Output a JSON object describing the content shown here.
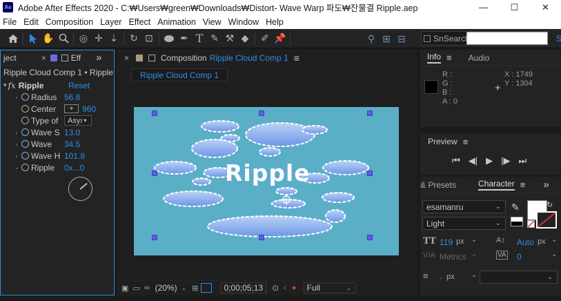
{
  "app": {
    "logo": "Ae",
    "title": "Adobe After Effects 2020 - C:₩Users₩green₩Downloads₩Distort- Wave Warp 파도₩잔물결 Ripple.aep"
  },
  "window_controls": {
    "minimize": "—",
    "maximize": "☐",
    "close": "✕"
  },
  "menu": [
    "File",
    "Edit",
    "Composition",
    "Layer",
    "Effect",
    "Animation",
    "View",
    "Window",
    "Help"
  ],
  "toolbar": {
    "search_help_placeholder": "Search Help",
    "search_help_fragment": "Sn",
    "right_edge_text": "S"
  },
  "effects_panel": {
    "tab_project_fragment": "ject",
    "tab_close": "×",
    "tab_effects_fragment": "Eff",
    "overflow": "»",
    "subtitle": "Ripple Cloud Comp 1 • Ripple",
    "effect_name": "Ripple",
    "reset_label": "Reset",
    "properties": [
      {
        "name": "Radius",
        "value": "56.8"
      },
      {
        "name": "Center",
        "value": "960"
      },
      {
        "name": "Type of",
        "value": "Asyı"
      },
      {
        "name": "Wave S",
        "value": "13.0"
      },
      {
        "name": "Wave",
        "value": "34.5"
      },
      {
        "name": "Wave H",
        "value": "101.8"
      },
      {
        "name": "Ripple",
        "value": "0x...0"
      }
    ]
  },
  "composition_panel": {
    "close": "×",
    "panel_label": "Composition",
    "comp_name": "Ripple Cloud Comp 1",
    "menu_glyph": "≡",
    "tab_label": "Ripple Cloud Comp 1",
    "canvas_text": "Ripple",
    "footer": {
      "zoom": "(20%)",
      "timecode": "0;00;05;13",
      "resolution": "Full"
    }
  },
  "info_panel": {
    "tab_info": "Info",
    "tab_audio": "Audio",
    "menu_glyph": "≡",
    "r_label": "R :",
    "g_label": "G :",
    "b_label": "B :",
    "a_label": "A :",
    "a_value": "0",
    "x_label": "X :",
    "x_value": "1749",
    "y_label": "Y :",
    "y_value": "1304"
  },
  "preview_panel": {
    "tab_label": "Preview",
    "menu_glyph": "≡"
  },
  "character_panel": {
    "tab_presets_fragment": "& Presets",
    "tab_character": "Character",
    "menu_glyph": "≡",
    "font_family": "esamanru",
    "font_style": "Light",
    "font_size": "119",
    "font_size_unit": "px",
    "leading": "Auto",
    "leading_unit": "px",
    "kerning": "Metrics",
    "tracking": "0",
    "stroke_width": "-",
    "stroke_unit": "px"
  },
  "colors": {
    "accent": "#2d8ceb",
    "canvas_bg": "#5aaec6",
    "panel_bg": "#232323",
    "handle": "#5c5ce0"
  }
}
